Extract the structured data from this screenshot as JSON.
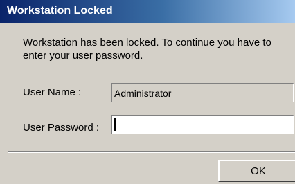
{
  "window": {
    "title": "Workstation Locked"
  },
  "message": "Workstation has been locked. To continue you have to enter your user password.",
  "form": {
    "user_name_label": "User Name :",
    "user_name_value": "Administrator",
    "password_label": "User Password :",
    "password_value": ""
  },
  "buttons": {
    "ok_label": "OK"
  },
  "colors": {
    "titlebar_start": "#0a246a",
    "titlebar_end": "#a6caf0",
    "dialog_background": "#d4d0c8"
  }
}
